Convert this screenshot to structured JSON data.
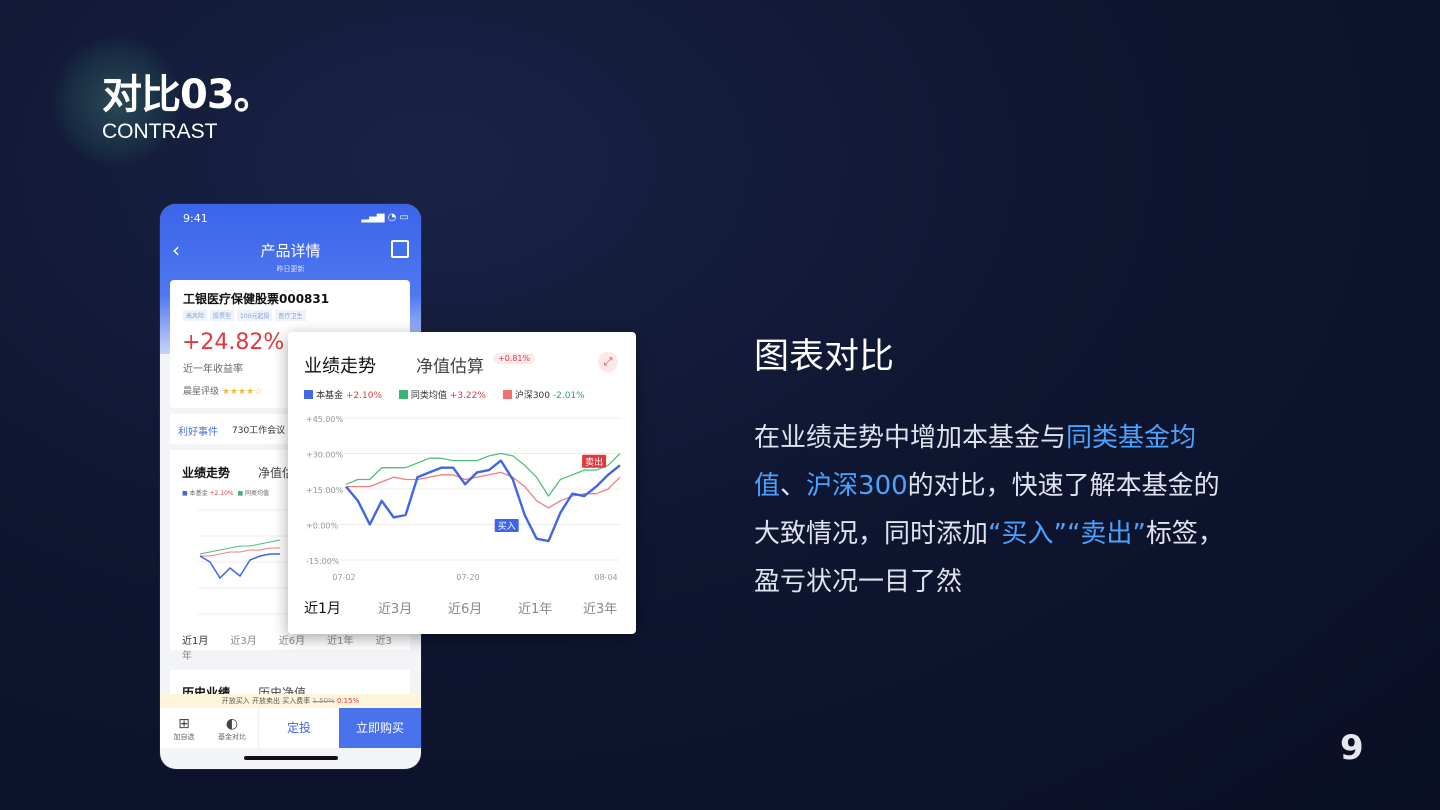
{
  "slide": {
    "title": "对比03。",
    "subtitle": "CONTRAST",
    "page_number": "9"
  },
  "right_text": {
    "heading": "图表对比",
    "desc_parts": [
      {
        "t": "在业绩走势中增加本基金与",
        "hl": false
      },
      {
        "t": "同类基金均值",
        "hl": true
      },
      {
        "t": "、",
        "hl": false
      },
      {
        "t": "沪深300",
        "hl": true
      },
      {
        "t": "的对比，快速了解本基金的大致情况，同时添加",
        "hl": false
      },
      {
        "t": "“买入”“卖出”",
        "hl": true
      },
      {
        "t": "标签，盈亏状况一目了然",
        "hl": false
      }
    ],
    "highlight_color": "#4aa3ff"
  },
  "phone": {
    "status_time": "9:41",
    "nav_title": "产品详情",
    "nav_sub": "昨日更新",
    "fund_name": "工银医疗保健股票000831",
    "tags": [
      "高风险",
      "股票型",
      "100元起投",
      "医疗卫生"
    ],
    "return_value": "+24.82%",
    "return_label": "近一年收益率",
    "rating_label": "晨星评级",
    "rating_stars": "★★★★☆",
    "event_label": "利好事件",
    "event_text": "730工作会议",
    "perf_title": "业绩走势",
    "perf_tab2": "净值估",
    "legend_fund": "本基金",
    "legend_fund_val": "+2.10%",
    "legend_peer": "同类均值",
    "periods": [
      "近1月",
      "近3月",
      "近6月",
      "近1年",
      "近3年"
    ],
    "history_title": "历史业绩",
    "history_tab2": "历史净值",
    "notice_text": "开放买入  开放卖出  买入费率",
    "notice_old_fee": "1.50%",
    "notice_fee": "0.15%",
    "bottom_add": "加自选",
    "bottom_compare": "基金对比",
    "btn_dingtou": "定投",
    "btn_buy": "立即购买"
  },
  "popup": {
    "tab1": "业绩走势",
    "tab2": "净值估算",
    "badge": "+0.81%",
    "legend": [
      {
        "name": "本基金",
        "value": "+2.10%",
        "color": "#4169e1",
        "dir": "up"
      },
      {
        "name": "同类均值",
        "value": "+3.22%",
        "color": "#3cb371",
        "dir": "up"
      },
      {
        "name": "沪深300",
        "value": "-2.01%",
        "color": "#f07070",
        "dir": "dn"
      }
    ],
    "periods": [
      "近1月",
      "近3月",
      "近6月",
      "近1年",
      "近3年"
    ],
    "buy_label": "买入",
    "sell_label": "卖出"
  },
  "chart_data": {
    "type": "line",
    "y_ticks": [
      "+45.00%",
      "+30.00%",
      "+15.00%",
      "+0.00%",
      "-15.00%"
    ],
    "x_ticks": [
      "07-02",
      "07-20",
      "08-04"
    ],
    "ylim": [
      -15,
      45
    ],
    "series": [
      {
        "name": "本基金",
        "color": "#3f66e8",
        "values": [
          16,
          10,
          0,
          10,
          3,
          4,
          20,
          22,
          24,
          24,
          17,
          22,
          23,
          27,
          19,
          4,
          -6,
          -7,
          5,
          13,
          12,
          16,
          21,
          25
        ]
      },
      {
        "name": "同类均值",
        "color": "#52c07d",
        "values": [
          17,
          19,
          19,
          24,
          24,
          24,
          26,
          28,
          28,
          27,
          27,
          27,
          29,
          30,
          29,
          25,
          20,
          12,
          19,
          21,
          23,
          23,
          25,
          30
        ]
      },
      {
        "name": "沪深300",
        "color": "#ef7f7f",
        "values": [
          16,
          16,
          16,
          18,
          20,
          19,
          19,
          20,
          21,
          21,
          19,
          20,
          21,
          22,
          20,
          16,
          10,
          7,
          10,
          12,
          13,
          13,
          15,
          20
        ]
      }
    ]
  }
}
